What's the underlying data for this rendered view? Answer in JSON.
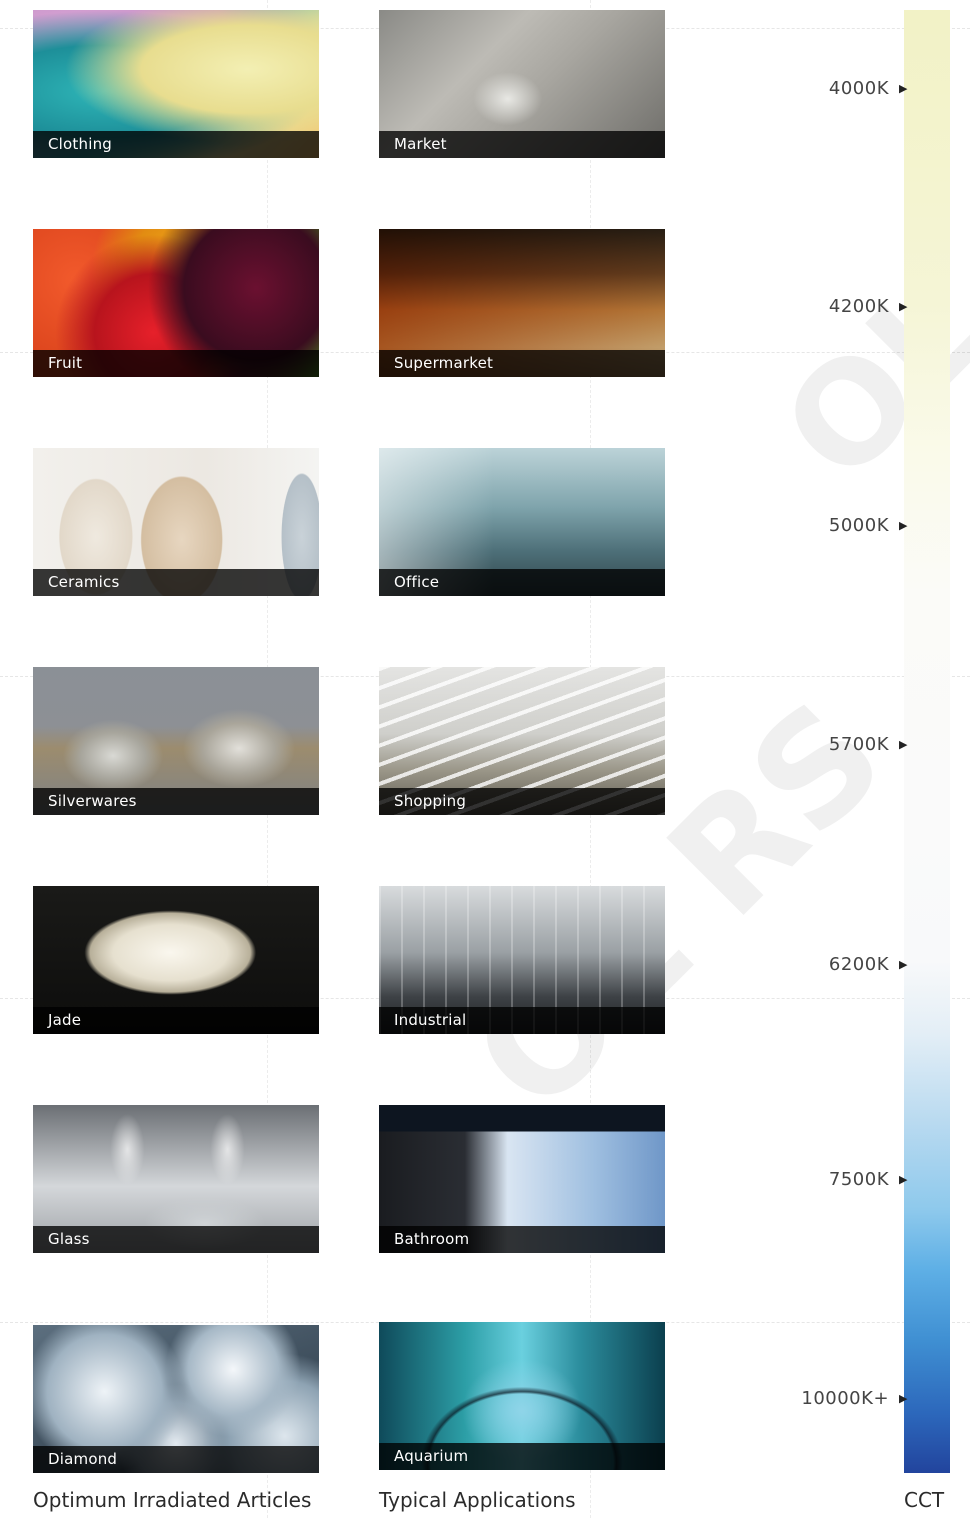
{
  "articles": {
    "heading": "Optimum Irradiated Articles",
    "items": [
      {
        "label": "Clothing"
      },
      {
        "label": "Fruit"
      },
      {
        "label": "Ceramics"
      },
      {
        "label": "Silverwares"
      },
      {
        "label": "Jade"
      },
      {
        "label": "Glass"
      },
      {
        "label": "Diamond"
      }
    ]
  },
  "applications": {
    "heading": "Typical Applications",
    "items": [
      {
        "label": "Market"
      },
      {
        "label": "Supermarket"
      },
      {
        "label": "Office"
      },
      {
        "label": "Shopping"
      },
      {
        "label": "Industrial"
      },
      {
        "label": "Bathroom"
      },
      {
        "label": "Aquarium"
      }
    ]
  },
  "cct": {
    "heading": "CCT",
    "ticks": [
      "4000K",
      "4200K",
      "5000K",
      "5700K",
      "6200K",
      "7500K",
      "10000K+"
    ],
    "marker_icon": "triangle-right-icon"
  },
  "colors": {
    "caption_bg": "#000000",
    "caption_text": "#ffffff",
    "warm": "#f2f2c6",
    "neutral": "#fafafa",
    "cool": "#22449d"
  }
}
